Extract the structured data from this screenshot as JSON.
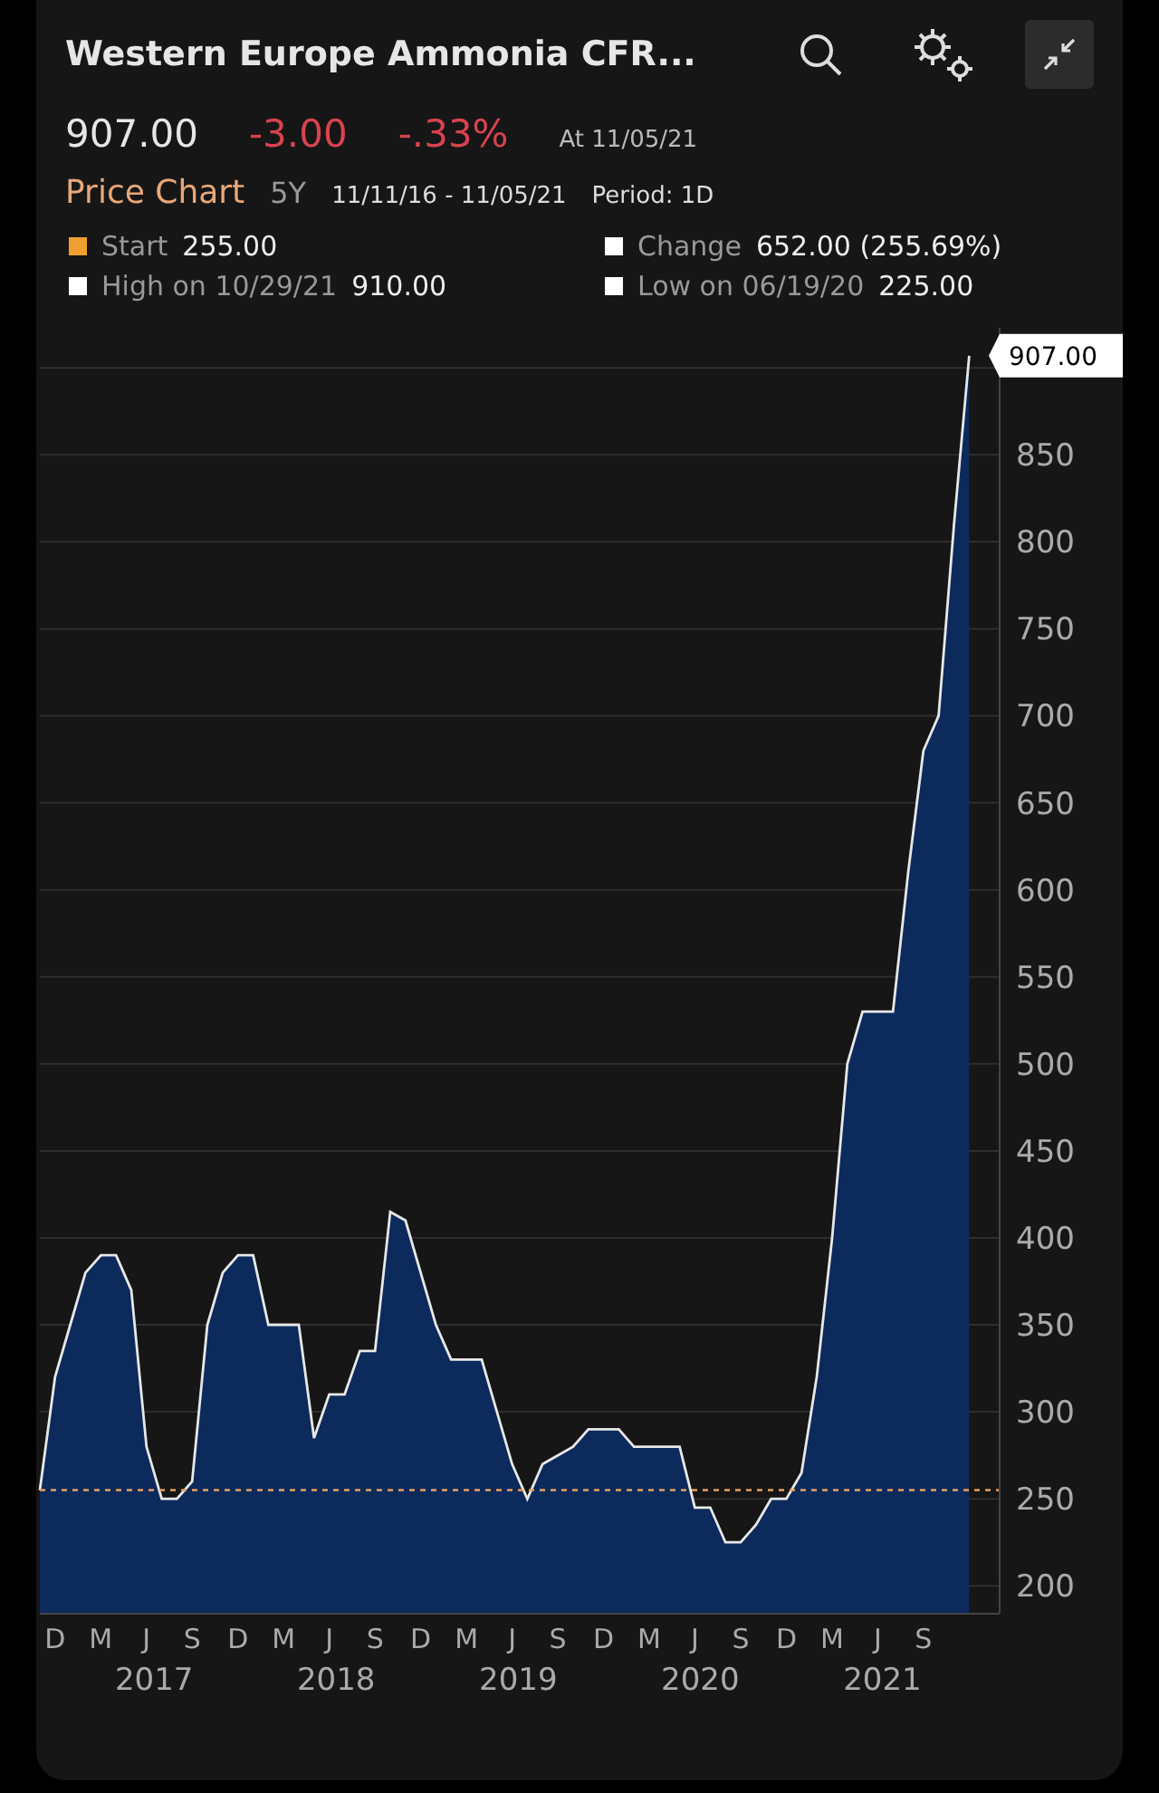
{
  "header": {
    "title": "Western Europe Ammonia CFR..."
  },
  "quote": {
    "price": "907.00",
    "change": "-3.00",
    "change_pct": "-.33%",
    "as_of": "At 11/05/21"
  },
  "chart_header": {
    "title": "Price Chart",
    "range": "5Y",
    "dates": "11/11/16 - 11/05/21",
    "period": "Period: 1D"
  },
  "stats": [
    {
      "label": "Start",
      "value": "255.00",
      "color": "#f0a030"
    },
    {
      "label": "Change",
      "value": "652.00 (255.69%)",
      "color": "#ffffff"
    },
    {
      "label": "High on 10/29/21",
      "value": "910.00",
      "color": "#ffffff"
    },
    {
      "label": "Low on 06/19/20",
      "value": "225.00",
      "color": "#ffffff"
    }
  ],
  "price_tag": "907.00",
  "year_labels": [
    "2017",
    "2018",
    "2019",
    "2020",
    "2021"
  ],
  "chart_data": {
    "type": "area",
    "ylim": [
      184,
      923
    ],
    "grid": true,
    "ref_lines": [
      {
        "axis": "y",
        "value": 255,
        "color": "#e8a060"
      }
    ],
    "categories": [
      null,
      "D",
      null,
      null,
      "M",
      null,
      null,
      "J",
      null,
      null,
      "S",
      null,
      null,
      "D",
      null,
      null,
      "M",
      null,
      null,
      "J",
      null,
      null,
      "S",
      null,
      null,
      "D",
      null,
      null,
      "M",
      null,
      null,
      "J",
      null,
      null,
      "S",
      null,
      null,
      "D",
      null,
      null,
      "M",
      null,
      null,
      "J",
      null,
      null,
      "S",
      null,
      null,
      "D",
      null,
      null,
      "M",
      null,
      null,
      "J",
      null,
      null,
      "S",
      null,
      null,
      null
    ],
    "series": [
      {
        "color": "#0c2a5c",
        "values": [
          255,
          320,
          350,
          380,
          390,
          390,
          370,
          280,
          250,
          250,
          260,
          350,
          380,
          390,
          390,
          350,
          350,
          350,
          285,
          310,
          310,
          335,
          335,
          415,
          410,
          380,
          350,
          330,
          330,
          330,
          300,
          270,
          250,
          270,
          275,
          280,
          290,
          290,
          290,
          280,
          280,
          280,
          280,
          245,
          245,
          225,
          225,
          235,
          250,
          250,
          265,
          320,
          400,
          500,
          530,
          530,
          530,
          610,
          680,
          700,
          810,
          907
        ]
      }
    ],
    "yticks": [
      200,
      250,
      300,
      350,
      400,
      450,
      500,
      550,
      600,
      650,
      700,
      750,
      800,
      850
    ]
  }
}
